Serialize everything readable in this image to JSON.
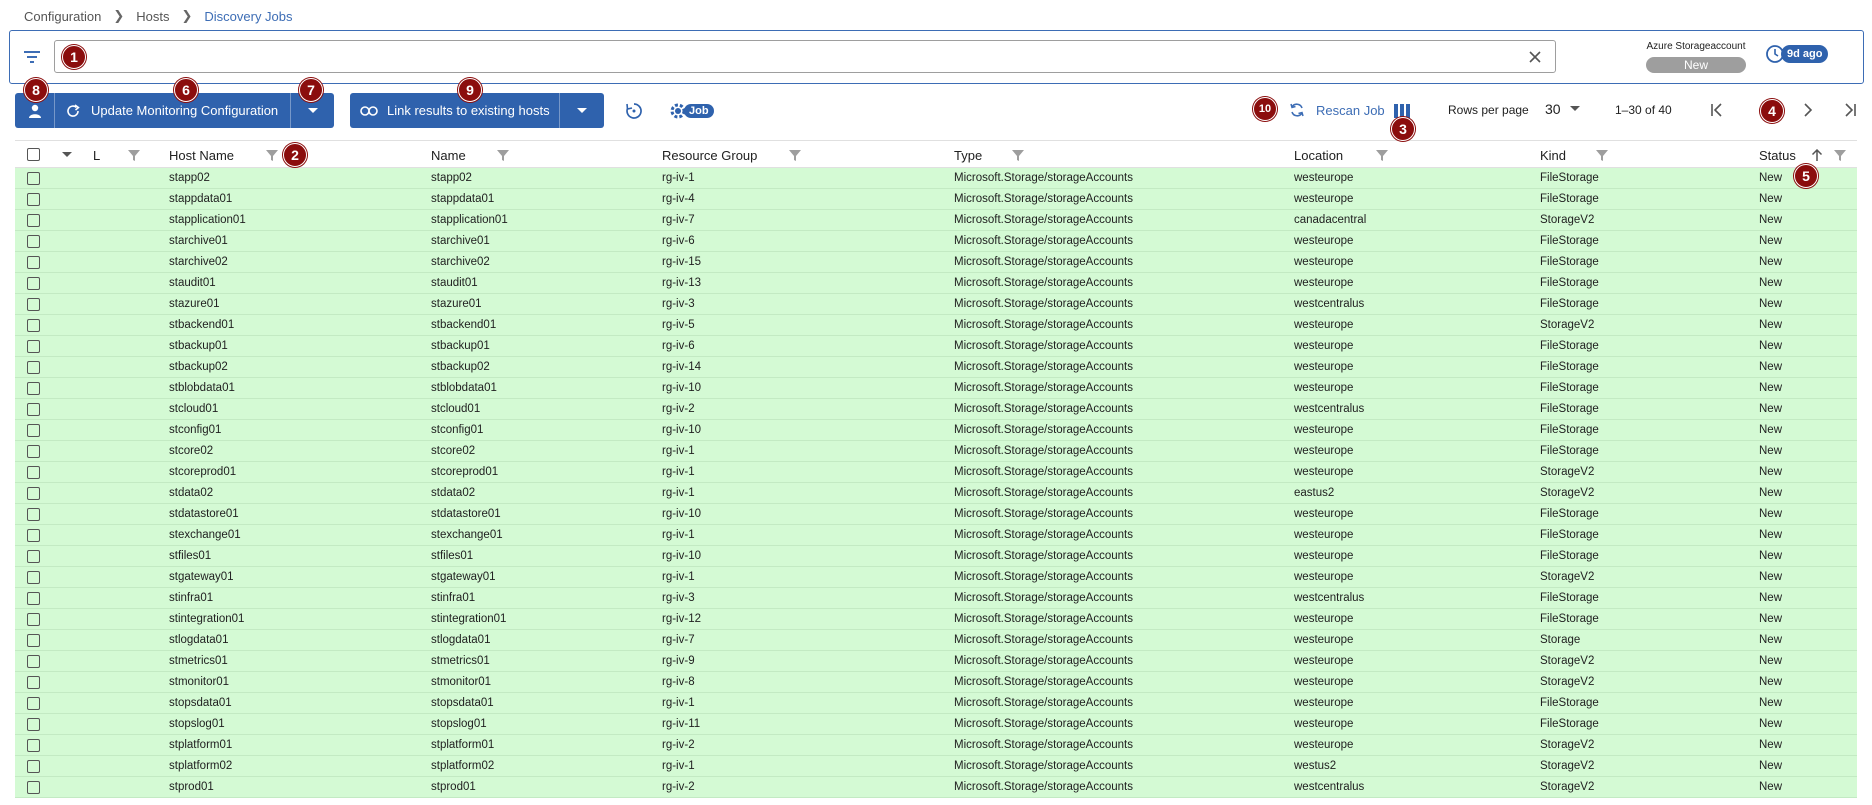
{
  "breadcrumb": [
    "Configuration",
    "Hosts",
    "Discovery Jobs"
  ],
  "filter": {
    "value": "",
    "placeholder": ""
  },
  "datasource": {
    "name": "Azure Storageaccount",
    "status": "New"
  },
  "age_badge": "9d ago",
  "toolbar": {
    "update_label": "Update Monitoring Configuration",
    "link_label": "Link results to existing hosts",
    "job_label": "Job",
    "rescan_label": "Rescan Job",
    "rows_label": "Rows per page",
    "rows_value": "30",
    "range_label": "1–30 of 40"
  },
  "columns": [
    "L",
    "Host Name",
    "Name",
    "Resource Group",
    "Type",
    "Location",
    "Kind",
    "Status"
  ],
  "rows": [
    [
      "stapp02",
      "stapp02",
      "rg-iv-1",
      "Microsoft.Storage/storageAccounts",
      "westeurope",
      "FileStorage",
      "New"
    ],
    [
      "stappdata01",
      "stappdata01",
      "rg-iv-4",
      "Microsoft.Storage/storageAccounts",
      "westeurope",
      "FileStorage",
      "New"
    ],
    [
      "stapplication01",
      "stapplication01",
      "rg-iv-7",
      "Microsoft.Storage/storageAccounts",
      "canadacentral",
      "StorageV2",
      "New"
    ],
    [
      "starchive01",
      "starchive01",
      "rg-iv-6",
      "Microsoft.Storage/storageAccounts",
      "westeurope",
      "FileStorage",
      "New"
    ],
    [
      "starchive02",
      "starchive02",
      "rg-iv-15",
      "Microsoft.Storage/storageAccounts",
      "westeurope",
      "FileStorage",
      "New"
    ],
    [
      "staudit01",
      "staudit01",
      "rg-iv-13",
      "Microsoft.Storage/storageAccounts",
      "westeurope",
      "FileStorage",
      "New"
    ],
    [
      "stazure01",
      "stazure01",
      "rg-iv-3",
      "Microsoft.Storage/storageAccounts",
      "westcentralus",
      "FileStorage",
      "New"
    ],
    [
      "stbackend01",
      "stbackend01",
      "rg-iv-5",
      "Microsoft.Storage/storageAccounts",
      "westeurope",
      "StorageV2",
      "New"
    ],
    [
      "stbackup01",
      "stbackup01",
      "rg-iv-6",
      "Microsoft.Storage/storageAccounts",
      "westeurope",
      "FileStorage",
      "New"
    ],
    [
      "stbackup02",
      "stbackup02",
      "rg-iv-14",
      "Microsoft.Storage/storageAccounts",
      "westeurope",
      "FileStorage",
      "New"
    ],
    [
      "stblobdata01",
      "stblobdata01",
      "rg-iv-10",
      "Microsoft.Storage/storageAccounts",
      "westeurope",
      "FileStorage",
      "New"
    ],
    [
      "stcloud01",
      "stcloud01",
      "rg-iv-2",
      "Microsoft.Storage/storageAccounts",
      "westcentralus",
      "FileStorage",
      "New"
    ],
    [
      "stconfig01",
      "stconfig01",
      "rg-iv-10",
      "Microsoft.Storage/storageAccounts",
      "westeurope",
      "FileStorage",
      "New"
    ],
    [
      "stcore02",
      "stcore02",
      "rg-iv-1",
      "Microsoft.Storage/storageAccounts",
      "westeurope",
      "FileStorage",
      "New"
    ],
    [
      "stcoreprod01",
      "stcoreprod01",
      "rg-iv-1",
      "Microsoft.Storage/storageAccounts",
      "westeurope",
      "StorageV2",
      "New"
    ],
    [
      "stdata02",
      "stdata02",
      "rg-iv-1",
      "Microsoft.Storage/storageAccounts",
      "eastus2",
      "StorageV2",
      "New"
    ],
    [
      "stdatastore01",
      "stdatastore01",
      "rg-iv-10",
      "Microsoft.Storage/storageAccounts",
      "westeurope",
      "FileStorage",
      "New"
    ],
    [
      "stexchange01",
      "stexchange01",
      "rg-iv-1",
      "Microsoft.Storage/storageAccounts",
      "westeurope",
      "FileStorage",
      "New"
    ],
    [
      "stfiles01",
      "stfiles01",
      "rg-iv-10",
      "Microsoft.Storage/storageAccounts",
      "westeurope",
      "FileStorage",
      "New"
    ],
    [
      "stgateway01",
      "stgateway01",
      "rg-iv-1",
      "Microsoft.Storage/storageAccounts",
      "westeurope",
      "StorageV2",
      "New"
    ],
    [
      "stinfra01",
      "stinfra01",
      "rg-iv-3",
      "Microsoft.Storage/storageAccounts",
      "westcentralus",
      "FileStorage",
      "New"
    ],
    [
      "stintegration01",
      "stintegration01",
      "rg-iv-12",
      "Microsoft.Storage/storageAccounts",
      "westeurope",
      "FileStorage",
      "New"
    ],
    [
      "stlogdata01",
      "stlogdata01",
      "rg-iv-7",
      "Microsoft.Storage/storageAccounts",
      "westeurope",
      "Storage",
      "New"
    ],
    [
      "stmetrics01",
      "stmetrics01",
      "rg-iv-9",
      "Microsoft.Storage/storageAccounts",
      "westeurope",
      "StorageV2",
      "New"
    ],
    [
      "stmonitor01",
      "stmonitor01",
      "rg-iv-8",
      "Microsoft.Storage/storageAccounts",
      "westeurope",
      "StorageV2",
      "New"
    ],
    [
      "stopsdata01",
      "stopsdata01",
      "rg-iv-1",
      "Microsoft.Storage/storageAccounts",
      "westeurope",
      "FileStorage",
      "New"
    ],
    [
      "stopslog01",
      "stopslog01",
      "rg-iv-11",
      "Microsoft.Storage/storageAccounts",
      "westeurope",
      "FileStorage",
      "New"
    ],
    [
      "stplatform01",
      "stplatform01",
      "rg-iv-2",
      "Microsoft.Storage/storageAccounts",
      "westeurope",
      "StorageV2",
      "New"
    ],
    [
      "stplatform02",
      "stplatform02",
      "rg-iv-1",
      "Microsoft.Storage/storageAccounts",
      "westus2",
      "StorageV2",
      "New"
    ],
    [
      "stprod01",
      "stprod01",
      "rg-iv-2",
      "Microsoft.Storage/storageAccounts",
      "westcentralus",
      "StorageV2",
      "New"
    ]
  ],
  "markers": [
    "1",
    "2",
    "3",
    "4",
    "5",
    "6",
    "7",
    "8",
    "9",
    "10"
  ],
  "colors": {
    "accent": "#2f62ad",
    "link": "#3d6db5",
    "row_bg": "#d4fad4",
    "marker": "#8b0d0d",
    "status_pill": "#9e9e9e"
  },
  "icons": [
    "filter-icon",
    "close-icon",
    "clock-icon",
    "user-icon",
    "refresh-icon",
    "chevron-down-icon",
    "link-icon",
    "reset-icon",
    "gear-icon",
    "sync-icon",
    "columns-icon",
    "first-page-icon",
    "prev-page-icon",
    "next-page-icon",
    "last-page-icon",
    "column-filter-icon",
    "sort-up-icon"
  ]
}
